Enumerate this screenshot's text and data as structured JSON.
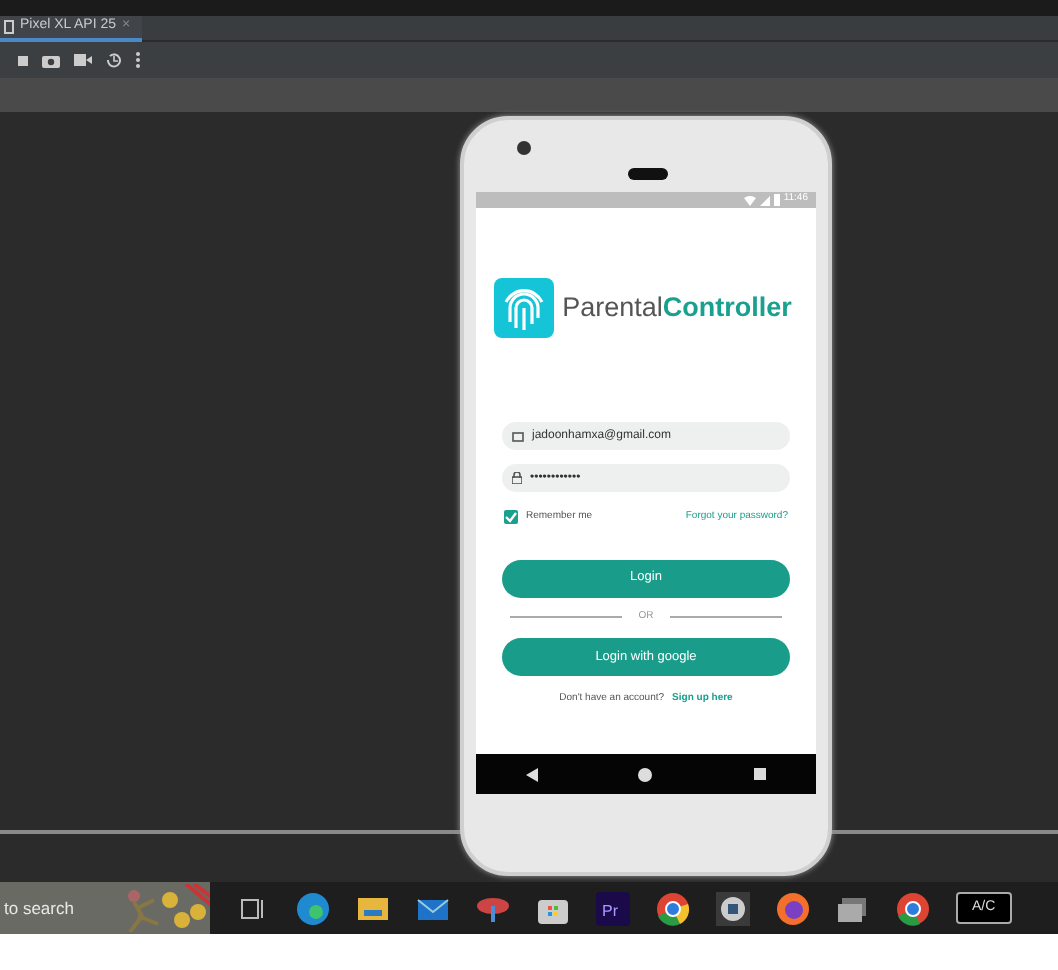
{
  "ide_tab": {
    "label": "Pixel XL API 25",
    "close": "×",
    "selected": true
  },
  "phone": {
    "status_time": "11:46",
    "app": {
      "logo_text_1": "Parental",
      "logo_text_2": "Controller",
      "email": {
        "value": "jadoonhamxa@gmail.com"
      },
      "password": {
        "value": "••••••••••••"
      },
      "remember": {
        "label": "Remember me",
        "checked": true
      },
      "forgot_link": "Forgot your password?",
      "login_button": "Login",
      "divider_text": "OR",
      "google_button": "Login with google",
      "signup_prompt": "Don't have an account?",
      "signup_link": "Sign up here"
    }
  },
  "taskbar": {
    "search_text": "to search",
    "premiere_label": "Pr",
    "battery_label": "A/C"
  }
}
